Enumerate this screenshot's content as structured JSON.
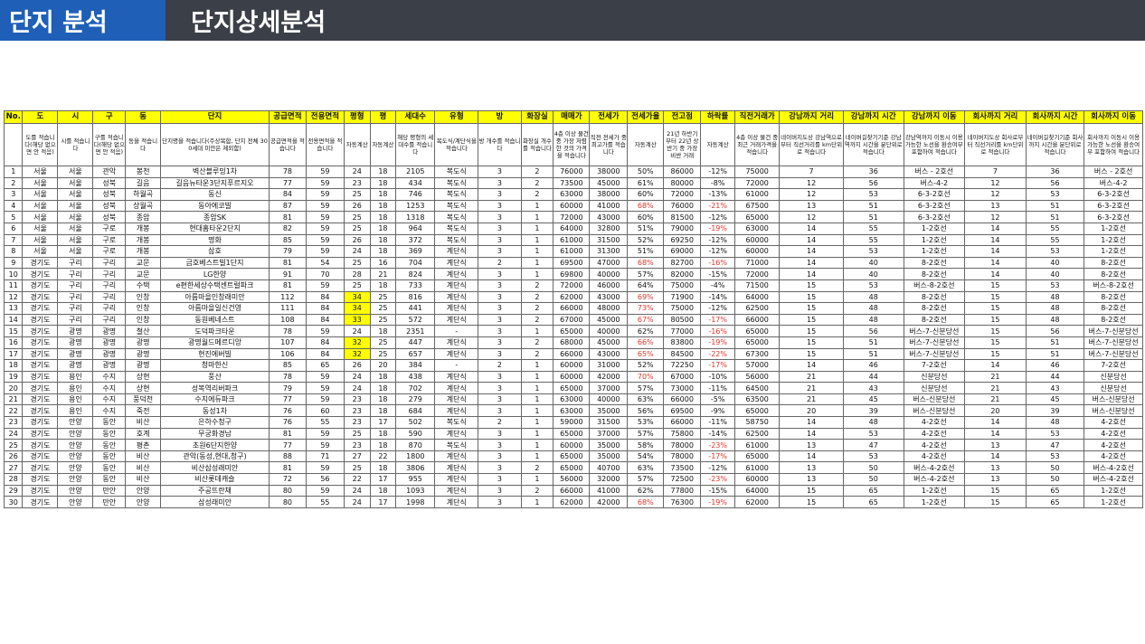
{
  "header": {
    "section": "단지 분석",
    "title": "단지상세분석"
  },
  "colors": {
    "header_blue": "#1f5fb8",
    "header_dark": "#3a3f48",
    "highlight": "#ffff00",
    "negative": "#e0352b"
  },
  "table": {
    "columns": [
      "No.",
      "도",
      "시",
      "구",
      "동",
      "단지",
      "공급면적",
      "전용면적",
      "평형",
      "평",
      "세대수",
      "유형",
      "방",
      "화장실",
      "매매가",
      "전세가",
      "전세가율",
      "전고점",
      "하락률",
      "직전거래가",
      "강남까지 거리",
      "강남까지 시간",
      "강남까지 이동",
      "회사까지 거리",
      "회사까지 시간",
      "회사까지 이동"
    ],
    "descriptions": [
      "",
      "도를 적습니다(해당 없으면 안 적음)",
      "시를 적습니다",
      "구를 적습니다(해당 없으면 안 적음)",
      "동을 적습니다",
      "단지명을 적습니다(주상복합, 단지 전체 300세대 미만은 제외함)",
      "공급면적을 적습니다",
      "전용면적을 적습니다",
      "자동계산",
      "자동계산",
      "해당 평형의 세대수를 적습니다",
      "복도식/계단식을 적습니다",
      "방 개수를 적습니다",
      "화장실 개수를 적습니다",
      "4층 이상 물건 중 가장 저렴한 것의 가격을 적습니다",
      "직전 전세가 중 최고가를 적습니다",
      "자동계산",
      "21년 하반기부터 22년 상반기 중 가장 비싼 거래",
      "자동계산",
      "4층 이상 물건 중 최근 거래가격을 적습니다",
      "네이버지도상 강남역으로부터 직선거리를 km단위로 적습니다",
      "네이버길찾기기준 강남역까지 시간을 분단위로 적습니다",
      "강남역까지 이동시 이용가능한 노선을 환승여부 포함하여 적습니다",
      "네이버지도상 회사로부터 직선거리를 km단위로 적습니다",
      "네이버길찾기기준 회사까지 시간을 분단위로 적습니다",
      "회사까지 이동시 이용가능한 노선을 환승여부 포함하여 적습니다"
    ],
    "rows": [
      [
        "1",
        "서울",
        "서울",
        "관악",
        "봉천",
        "벽산블루밍1차",
        "78",
        "59",
        "24",
        "18",
        "2105",
        "복도식",
        "3",
        "2",
        "76000",
        "38000",
        "50%",
        "86000",
        "-12%",
        "75000",
        "7",
        "36",
        "버스 - 2호선",
        "7",
        "36",
        "버스 - 2호선"
      ],
      [
        "2",
        "서울",
        "서울",
        "성북",
        "길음",
        "길음뉴타운3단지푸르지오",
        "77",
        "59",
        "23",
        "18",
        "434",
        "복도식",
        "3",
        "2",
        "73500",
        "45000",
        "61%",
        "80000",
        "-8%",
        "72000",
        "12",
        "56",
        "버스-4-2",
        "12",
        "56",
        "버스-4-2"
      ],
      [
        "3",
        "서울",
        "서울",
        "성북",
        "하월곡",
        "동신",
        "84",
        "59",
        "25",
        "18",
        "746",
        "복도식",
        "3",
        "2",
        "63000",
        "38000",
        "60%",
        "72000",
        "-13%",
        "61000",
        "12",
        "53",
        "6-3-2호선",
        "12",
        "53",
        "6-3-2호선"
      ],
      [
        "4",
        "서울",
        "서울",
        "성북",
        "상월곡",
        "동아에코빌",
        "87",
        "59",
        "26",
        "18",
        "1253",
        "복도식",
        "3",
        "1",
        "60000",
        "41000",
        "68%",
        "76000",
        "-21%",
        "67500",
        "13",
        "51",
        "6-3-2호선",
        "13",
        "51",
        "6-3-2호선"
      ],
      [
        "5",
        "서울",
        "서울",
        "성북",
        "종암",
        "종암SK",
        "81",
        "59",
        "25",
        "18",
        "1318",
        "복도식",
        "3",
        "1",
        "72000",
        "43000",
        "60%",
        "81500",
        "-12%",
        "65000",
        "12",
        "51",
        "6-3-2호선",
        "12",
        "51",
        "6-3-2호선"
      ],
      [
        "6",
        "서울",
        "서울",
        "구로",
        "개봉",
        "현대홈타운2단지",
        "82",
        "59",
        "25",
        "18",
        "964",
        "복도식",
        "3",
        "1",
        "64000",
        "32800",
        "51%",
        "79000",
        "-19%",
        "63000",
        "14",
        "55",
        "1-2호선",
        "14",
        "55",
        "1-2호선"
      ],
      [
        "7",
        "서울",
        "서울",
        "구로",
        "개봉",
        "명화",
        "85",
        "59",
        "26",
        "18",
        "372",
        "복도식",
        "3",
        "1",
        "61000",
        "31500",
        "52%",
        "69250",
        "-12%",
        "60000",
        "14",
        "55",
        "1-2호선",
        "14",
        "55",
        "1-2호선"
      ],
      [
        "8",
        "서울",
        "서울",
        "구로",
        "개봉",
        "삼호",
        "79",
        "59",
        "24",
        "18",
        "369",
        "계단식",
        "3",
        "1",
        "61000",
        "31300",
        "51%",
        "69000",
        "-12%",
        "60000",
        "14",
        "53",
        "1-2호선",
        "14",
        "53",
        "1-2호선"
      ],
      [
        "9",
        "경기도",
        "구리",
        "구리",
        "교문",
        "금호베스트빌1단지",
        "81",
        "54",
        "25",
        "16",
        "704",
        "계단식",
        "2",
        "1",
        "69500",
        "47000",
        "68%",
        "82700",
        "-16%",
        "71000",
        "14",
        "40",
        "8-2호선",
        "14",
        "40",
        "8-2호선"
      ],
      [
        "10",
        "경기도",
        "구리",
        "구리",
        "교문",
        "LG한양",
        "91",
        "70",
        "28",
        "21",
        "824",
        "계단식",
        "3",
        "1",
        "69800",
        "40000",
        "57%",
        "82000",
        "-15%",
        "72000",
        "14",
        "40",
        "8-2호선",
        "14",
        "40",
        "8-2호선"
      ],
      [
        "11",
        "경기도",
        "구리",
        "구리",
        "수택",
        "e편한세상수택센트럴파크",
        "81",
        "59",
        "25",
        "18",
        "733",
        "계단식",
        "3",
        "2",
        "72000",
        "46000",
        "64%",
        "75000",
        "-4%",
        "71500",
        "15",
        "53",
        "버스-8-2호선",
        "15",
        "53",
        "버스-8-2호선"
      ],
      [
        "12",
        "경기도",
        "구리",
        "구리",
        "인창",
        "아름마을인창래미안",
        "112",
        "84",
        "34",
        "25",
        "816",
        "계단식",
        "3",
        "2",
        "62000",
        "43000",
        "69%",
        "71900",
        "-14%",
        "64000",
        "15",
        "48",
        "8-2호선",
        "15",
        "48",
        "8-2호선"
      ],
      [
        "13",
        "경기도",
        "구리",
        "구리",
        "인창",
        "아름마을일신건영",
        "111",
        "84",
        "34",
        "25",
        "441",
        "계단식",
        "3",
        "2",
        "66000",
        "48000",
        "73%",
        "75000",
        "-12%",
        "62500",
        "15",
        "48",
        "8-2호선",
        "15",
        "48",
        "8-2호선"
      ],
      [
        "14",
        "경기도",
        "구리",
        "구리",
        "인창",
        "동원베네스트",
        "108",
        "84",
        "33",
        "25",
        "572",
        "계단식",
        "3",
        "2",
        "67000",
        "45000",
        "67%",
        "80500",
        "-17%",
        "66000",
        "15",
        "48",
        "8-2호선",
        "15",
        "48",
        "8-2호선"
      ],
      [
        "15",
        "경기도",
        "광명",
        "광명",
        "철산",
        "도덕파크타운",
        "78",
        "59",
        "24",
        "18",
        "2351",
        "-",
        "3",
        "1",
        "65000",
        "40000",
        "62%",
        "77000",
        "-16%",
        "65000",
        "15",
        "56",
        "버스-7-신분당선",
        "15",
        "56",
        "버스-7-신분당선"
      ],
      [
        "16",
        "경기도",
        "광명",
        "광명",
        "광명",
        "광명월드메르디앙",
        "107",
        "84",
        "32",
        "25",
        "447",
        "계단식",
        "3",
        "2",
        "68000",
        "45000",
        "66%",
        "83800",
        "-19%",
        "65000",
        "15",
        "51",
        "버스-7-신분당선",
        "15",
        "51",
        "버스-7-신분당선"
      ],
      [
        "17",
        "경기도",
        "광명",
        "광명",
        "광명",
        "현진에버빌",
        "106",
        "84",
        "32",
        "25",
        "657",
        "계단식",
        "3",
        "2",
        "66000",
        "43000",
        "65%",
        "84500",
        "-22%",
        "67300",
        "15",
        "51",
        "버스-7-신분당선",
        "15",
        "51",
        "버스-7-신분당선"
      ],
      [
        "18",
        "경기도",
        "광명",
        "광명",
        "광명",
        "청마한신",
        "85",
        "65",
        "26",
        "20",
        "384",
        "-",
        "2",
        "1",
        "60000",
        "31000",
        "52%",
        "72250",
        "-17%",
        "57000",
        "14",
        "46",
        "7-2호선",
        "14",
        "46",
        "7-2호선"
      ],
      [
        "19",
        "경기도",
        "용인",
        "수지",
        "상현",
        "풍산",
        "78",
        "59",
        "24",
        "18",
        "438",
        "계단식",
        "3",
        "1",
        "60000",
        "42000",
        "70%",
        "67000",
        "-10%",
        "56000",
        "21",
        "44",
        "신분당선",
        "21",
        "44",
        "신분당선"
      ],
      [
        "20",
        "경기도",
        "용인",
        "수지",
        "상현",
        "성복역리버파크",
        "79",
        "59",
        "24",
        "18",
        "702",
        "계단식",
        "3",
        "1",
        "65000",
        "37000",
        "57%",
        "73000",
        "-11%",
        "64500",
        "21",
        "43",
        "신분당선",
        "21",
        "43",
        "신분당선"
      ],
      [
        "21",
        "경기도",
        "용인",
        "수지",
        "풍덕천",
        "수지에듀파크",
        "77",
        "59",
        "23",
        "18",
        "279",
        "계단식",
        "3",
        "1",
        "63000",
        "40000",
        "63%",
        "66000",
        "-5%",
        "63500",
        "21",
        "45",
        "버스-신분당선",
        "21",
        "45",
        "버스-신분당선"
      ],
      [
        "22",
        "경기도",
        "용인",
        "수지",
        "죽전",
        "동성1차",
        "76",
        "60",
        "23",
        "18",
        "684",
        "계단식",
        "3",
        "1",
        "63000",
        "35000",
        "56%",
        "69500",
        "-9%",
        "65000",
        "20",
        "39",
        "버스-신분당선",
        "20",
        "39",
        "버스-신분당선"
      ],
      [
        "23",
        "경기도",
        "안양",
        "동안",
        "비산",
        "은하수청구",
        "76",
        "55",
        "23",
        "17",
        "502",
        "복도식",
        "2",
        "1",
        "59000",
        "31500",
        "53%",
        "66000",
        "-11%",
        "58750",
        "14",
        "48",
        "4-2호선",
        "14",
        "48",
        "4-2호선"
      ],
      [
        "24",
        "경기도",
        "안양",
        "동안",
        "호계",
        "무궁화경남",
        "81",
        "59",
        "25",
        "18",
        "590",
        "계단식",
        "3",
        "1",
        "65000",
        "37000",
        "57%",
        "75800",
        "-14%",
        "62500",
        "14",
        "53",
        "4-2호선",
        "14",
        "53",
        "4-2호선"
      ],
      [
        "25",
        "경기도",
        "안양",
        "동안",
        "평촌",
        "초원6단지한양",
        "77",
        "59",
        "23",
        "18",
        "870",
        "복도식",
        "3",
        "1",
        "60000",
        "35000",
        "58%",
        "78000",
        "-23%",
        "61000",
        "13",
        "47",
        "4-2호선",
        "13",
        "47",
        "4-2호선"
      ],
      [
        "26",
        "경기도",
        "안양",
        "동안",
        "비산",
        "관악(동성,현대,청구)",
        "88",
        "71",
        "27",
        "22",
        "1800",
        "계단식",
        "3",
        "1",
        "65000",
        "35000",
        "54%",
        "78000",
        "-17%",
        "65000",
        "14",
        "53",
        "4-2호선",
        "14",
        "53",
        "4-2호선"
      ],
      [
        "27",
        "경기도",
        "안양",
        "동안",
        "비산",
        "비산삼성래미안",
        "81",
        "59",
        "25",
        "18",
        "3806",
        "계단식",
        "3",
        "2",
        "65000",
        "40700",
        "63%",
        "73500",
        "-12%",
        "61000",
        "13",
        "50",
        "버스-4-2호선",
        "13",
        "50",
        "버스-4-2호선"
      ],
      [
        "28",
        "경기도",
        "안양",
        "동안",
        "비산",
        "비산롯데캐슬",
        "72",
        "56",
        "22",
        "17",
        "955",
        "계단식",
        "3",
        "1",
        "56000",
        "32000",
        "57%",
        "72500",
        "-23%",
        "60000",
        "13",
        "50",
        "버스-4-2호선",
        "13",
        "50",
        "버스-4-2호선"
      ],
      [
        "29",
        "경기도",
        "안양",
        "만안",
        "안양",
        "주공뜨란채",
        "80",
        "59",
        "24",
        "18",
        "1093",
        "계단식",
        "3",
        "2",
        "66000",
        "41000",
        "62%",
        "77800",
        "-15%",
        "64000",
        "15",
        "65",
        "1-2호선",
        "15",
        "65",
        "1-2호선"
      ],
      [
        "30",
        "경기도",
        "안양",
        "만안",
        "안양",
        "삼성래미안",
        "80",
        "55",
        "24",
        "17",
        "1998",
        "계단식",
        "3",
        "1",
        "62000",
        "42000",
        "68%",
        "76300",
        "-19%",
        "62000",
        "15",
        "65",
        "1-2호선",
        "15",
        "65",
        "1-2호선"
      ]
    ]
  }
}
